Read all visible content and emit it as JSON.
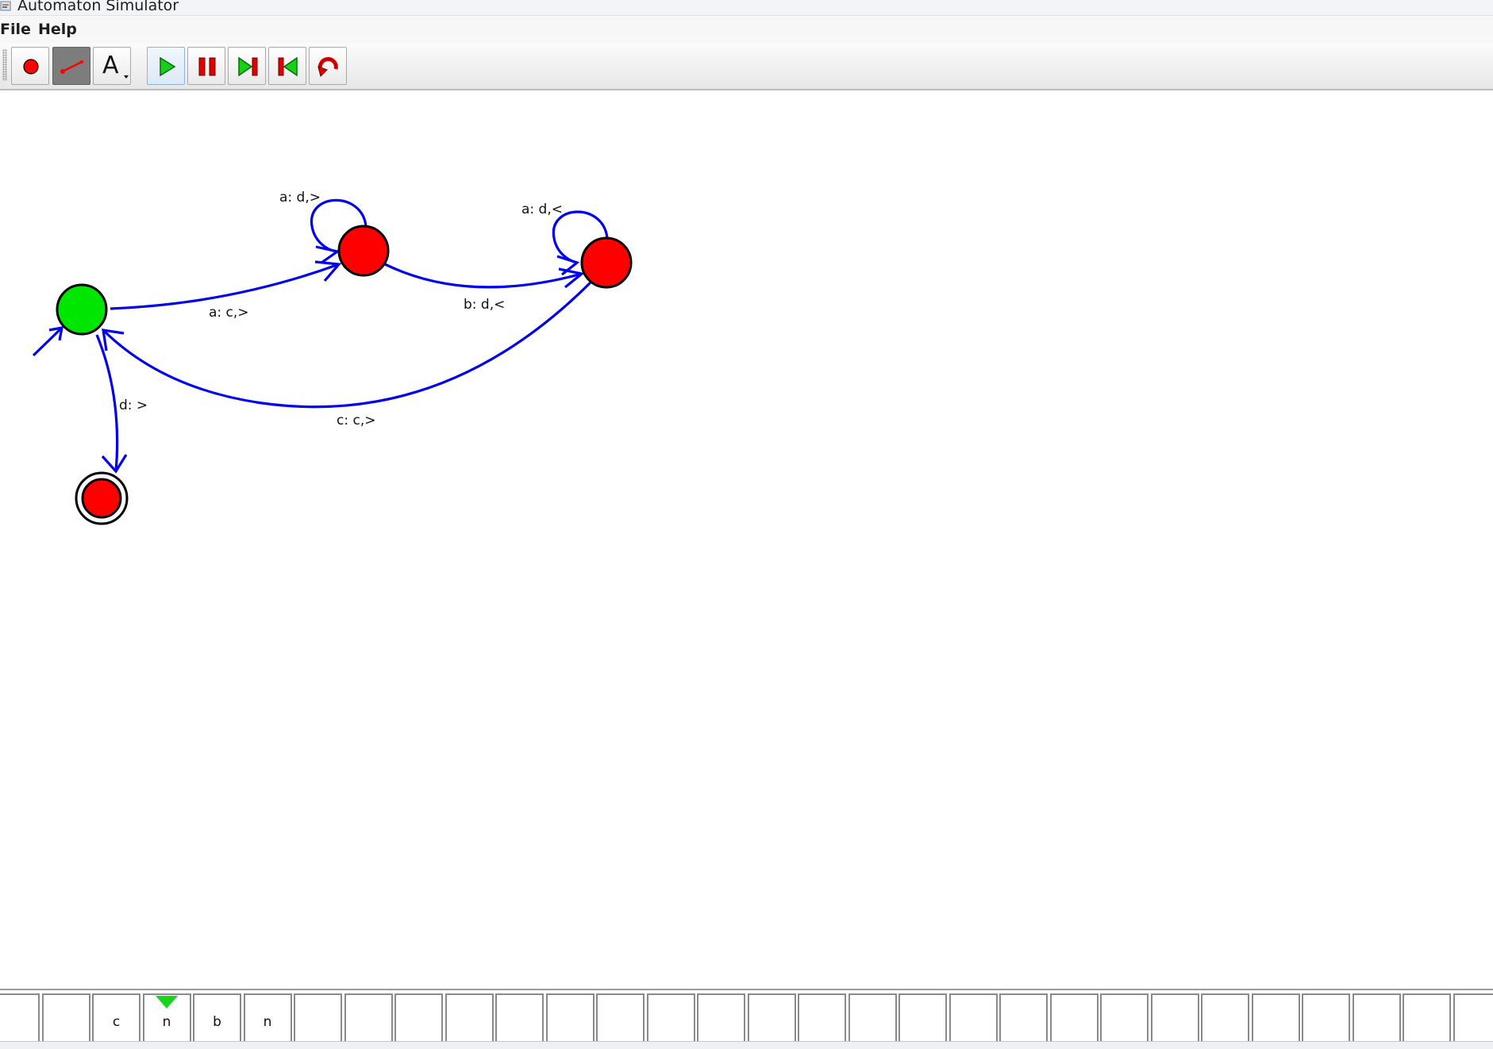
{
  "window": {
    "title": "Automaton Simulator",
    "icon": "java-app-icon"
  },
  "menu": [
    {
      "label": "File"
    },
    {
      "label": "Help"
    }
  ],
  "toolbar": {
    "tools": [
      {
        "name": "add-state-tool",
        "icon": "red-circle-icon",
        "pressed": false
      },
      {
        "name": "add-transition-tool",
        "icon": "arrow-line-icon",
        "pressed": true
      },
      {
        "name": "text-tool",
        "icon": "letter-a-dropdown-icon",
        "label": "A",
        "pressed": false
      }
    ],
    "controls": [
      {
        "name": "play-button",
        "icon": "play-icon"
      },
      {
        "name": "pause-button",
        "icon": "pause-icon"
      },
      {
        "name": "step-forward-button",
        "icon": "step-forward-icon"
      },
      {
        "name": "step-back-button",
        "icon": "step-back-icon"
      },
      {
        "name": "reset-button",
        "icon": "reset-icon"
      }
    ]
  },
  "automaton": {
    "states": [
      {
        "id": "q0",
        "role": "current",
        "color": "#00e600",
        "initial": true,
        "accepting": false
      },
      {
        "id": "q1",
        "role": "normal",
        "color": "#ff0000",
        "initial": false,
        "accepting": false
      },
      {
        "id": "q2",
        "role": "normal",
        "color": "#ff0000",
        "initial": false,
        "accepting": false
      },
      {
        "id": "q3",
        "role": "normal",
        "color": "#ff0000",
        "initial": false,
        "accepting": true
      }
    ],
    "transitions": [
      {
        "from": "q0",
        "to": "q1",
        "label": "a: c,>"
      },
      {
        "from": "q1",
        "to": "q1",
        "label": "a: d,>"
      },
      {
        "from": "q1",
        "to": "q2",
        "label": "b: d,<"
      },
      {
        "from": "q2",
        "to": "q2",
        "label": "a: d,<"
      },
      {
        "from": "q2",
        "to": "q0",
        "label": "c: c,>"
      },
      {
        "from": "q0",
        "to": "q3",
        "label": "d: >"
      }
    ],
    "edge_color": "#0000ee"
  },
  "tape": {
    "cells": [
      "",
      "",
      "c",
      "n",
      "b",
      "n",
      "",
      "",
      "",
      "",
      "",
      "",
      "",
      "",
      "",
      "",
      "",
      "",
      "",
      "",
      "",
      "",
      "",
      "",
      "",
      "",
      "",
      "",
      "",
      ""
    ],
    "head_index": 3,
    "head_color": "#15d61a"
  }
}
